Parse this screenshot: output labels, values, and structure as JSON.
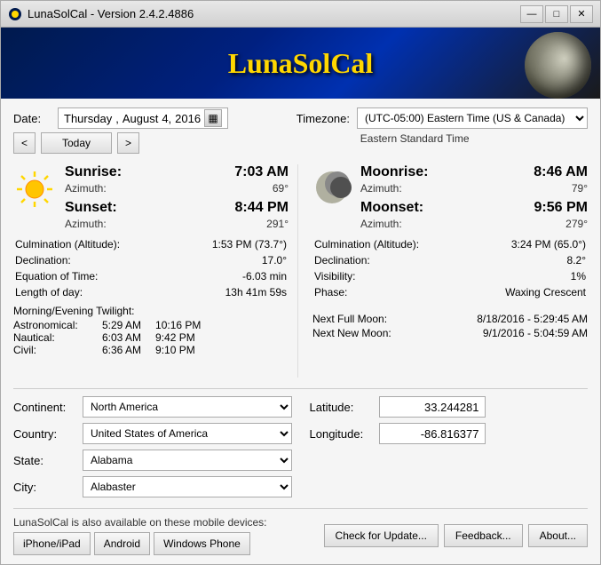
{
  "window": {
    "title": "LunaSolCal - Version 2.4.2.4886",
    "min_btn": "—",
    "max_btn": "□",
    "close_btn": "✕"
  },
  "header": {
    "app_name": "LunaSolCal"
  },
  "date_section": {
    "label": "Date:",
    "day": "Thursday",
    "sep1": ",",
    "month": "August",
    "day_num": "4,",
    "year": "2016",
    "prev_btn": "<",
    "today_btn": "Today",
    "next_btn": ">"
  },
  "timezone": {
    "label": "Timezone:",
    "value": "(UTC-05:00) Eastern Time (US & Canada)",
    "subtext": "Eastern Standard Time"
  },
  "sun": {
    "sunrise_label": "Sunrise:",
    "sunrise_time": "7:03 AM",
    "sunrise_az_label": "Azimuth:",
    "sunrise_az": "69°",
    "sunset_label": "Sunset:",
    "sunset_time": "8:44 PM",
    "sunset_az_label": "Azimuth:",
    "sunset_az": "291°",
    "culmination_label": "Culmination (Altitude):",
    "culmination_val": "1:53 PM (73.7°)",
    "declination_label": "Declination:",
    "declination_val": "17.0°",
    "eot_label": "Equation of Time:",
    "eot_val": "-6.03 min",
    "day_length_label": "Length of day:",
    "day_length_val": "13h 41m 59s",
    "twilight_title": "Morning/Evening Twilight:",
    "astronomical_label": "Astronomical:",
    "astronomical_am": "5:29 AM",
    "astronomical_pm": "10:16 PM",
    "nautical_label": "Nautical:",
    "nautical_am": "6:03 AM",
    "nautical_pm": "9:42 PM",
    "civil_label": "Civil:",
    "civil_am": "6:36 AM",
    "civil_pm": "9:10 PM"
  },
  "moon": {
    "moonrise_label": "Moonrise:",
    "moonrise_time": "8:46 AM",
    "moonrise_az_label": "Azimuth:",
    "moonrise_az": "79°",
    "moonset_label": "Moonset:",
    "moonset_time": "9:56 PM",
    "moonset_az_label": "Azimuth:",
    "moonset_az": "279°",
    "culmination_label": "Culmination (Altitude):",
    "culmination_val": "3:24 PM (65.0°)",
    "declination_label": "Declination:",
    "declination_val": "8.2°",
    "visibility_label": "Visibility:",
    "visibility_val": "1%",
    "phase_label": "Phase:",
    "phase_val": "Waxing Crescent",
    "next_full_label": "Next Full Moon:",
    "next_full_val": "8/18/2016 - 5:29:45 AM",
    "next_new_label": "Next New Moon:",
    "next_new_val": "9/1/2016 - 5:04:59 AM"
  },
  "location": {
    "continent_label": "Continent:",
    "continent_val": "North America",
    "country_label": "Country:",
    "country_val": "United States of America",
    "state_label": "State:",
    "state_val": "Alabama",
    "city_label": "City:",
    "city_val": "Alabaster",
    "latitude_label": "Latitude:",
    "latitude_val": "33.244281",
    "longitude_label": "Longitude:",
    "longitude_val": "-86.816377"
  },
  "bottom": {
    "mobile_text": "LunaSolCal is also available on these mobile devices:",
    "iphone_btn": "iPhone/iPad",
    "android_btn": "Android",
    "windowsphone_btn": "Windows Phone",
    "check_update_btn": "Check for Update...",
    "feedback_btn": "Feedback...",
    "about_btn": "About..."
  }
}
